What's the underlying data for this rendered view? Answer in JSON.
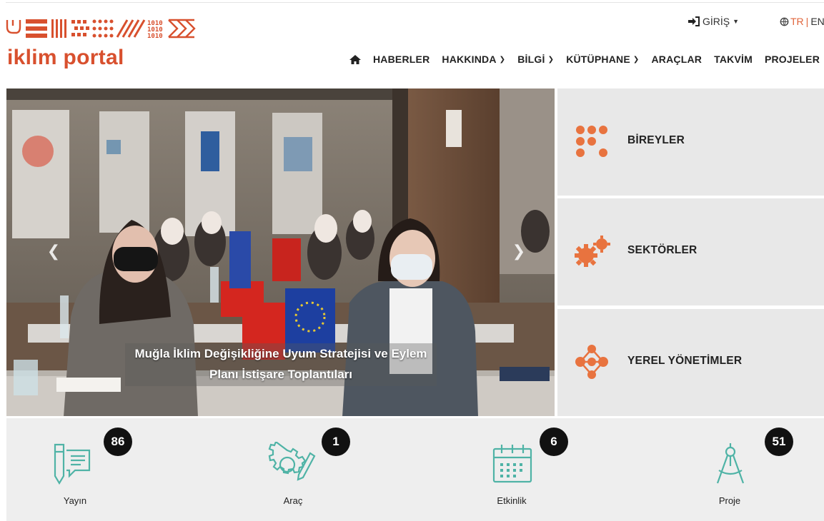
{
  "header": {
    "logo_text": "iklim portal",
    "login_label": "GİRİŞ",
    "lang": {
      "tr": "TR",
      "sep": "|",
      "en": "EN"
    }
  },
  "nav": {
    "items": [
      {
        "label": "HABERLER",
        "dropdown": false
      },
      {
        "label": "HAKKINDA",
        "dropdown": true
      },
      {
        "label": "BİLGİ",
        "dropdown": true
      },
      {
        "label": "KÜTÜPHANE",
        "dropdown": true
      },
      {
        "label": "ARAÇLAR",
        "dropdown": false
      },
      {
        "label": "TAKVİM",
        "dropdown": false
      },
      {
        "label": "PROJELER",
        "dropdown": false
      }
    ]
  },
  "slider": {
    "caption_line1": "Muğla İklim Değişikliğine Uyum Stratejisi ve Eylem",
    "caption_line2": "Planı İstişare Toplantıları"
  },
  "panels": [
    {
      "label": "BİREYLER",
      "icon": "dots-icon"
    },
    {
      "label": "SEKTÖRLER",
      "icon": "gears-icon"
    },
    {
      "label": "YEREL YÖNETİMLER",
      "icon": "network-icon"
    }
  ],
  "stats": [
    {
      "label": "Yayın",
      "count": "86",
      "icon": "publication-icon"
    },
    {
      "label": "Araç",
      "count": "1",
      "icon": "tool-icon"
    },
    {
      "label": "Etkinlik",
      "count": "6",
      "icon": "calendar-icon"
    },
    {
      "label": "Proje",
      "count": "51",
      "icon": "compass-icon"
    }
  ],
  "colors": {
    "brand": "#d8502e",
    "accent_orange": "#e8733f",
    "icon_teal": "#4fb3a6",
    "panel_bg": "#e8e8e8",
    "stats_bg": "#eeeeee",
    "badge_bg": "#111111"
  }
}
